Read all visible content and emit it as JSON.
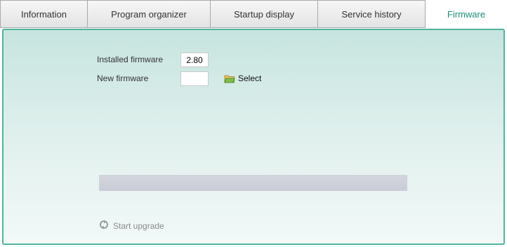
{
  "tabs": [
    {
      "label": "Information"
    },
    {
      "label": "Program organizer"
    },
    {
      "label": "Startup display"
    },
    {
      "label": "Service history"
    },
    {
      "label": "Firmware",
      "active": true
    }
  ],
  "firmware": {
    "installed_label": "Installed firmware",
    "installed_value": "2.80",
    "new_label": "New firmware",
    "new_value": "",
    "select_label": "Select",
    "select_icon": "folder-open-icon",
    "progress_percent": 0,
    "start_label": "Start upgrade",
    "start_icon": "refresh-icon"
  },
  "colors": {
    "accent": "#1a8c78",
    "panel_border": "#4fb59d"
  }
}
